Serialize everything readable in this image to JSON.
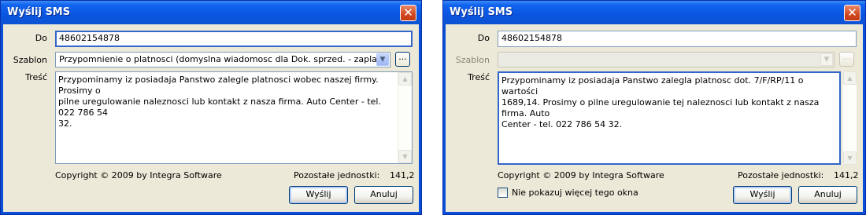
{
  "left": {
    "title": "Wyślij SMS",
    "close_glyph": "✕",
    "do_label": "Do",
    "do_value": "48602154878",
    "szablon_label": "Szablon",
    "szablon_value": "Przypomnienie o platnosci (domyslna wiadomosc dla Dok. sprzed. - zaplata).",
    "tresc_label": "Treść",
    "tresc_value": "Przypominamy iz posiadaja Panstwo zalegle platnosci wobec naszej firmy. Prosimy o\npilne uregulowanie naleznosci lub kontakt z nasza firma. Auto Center - tel. 022 786 54\n32.",
    "dots_label": "...",
    "copyright": "Copyright © 2009 by Integra Software",
    "remaining_label": "Pozostałe jednostki:",
    "remaining_value": "141,2",
    "send_label": "Wyślij",
    "cancel_label": "Anuluj"
  },
  "right": {
    "title": "Wyślij SMS",
    "close_glyph": "✕",
    "do_label": "Do",
    "do_value": "48602154878",
    "szablon_label": "Szablon",
    "szablon_value": "",
    "tresc_label": "Treść",
    "tresc_value": "Przypominamy iz posiadaja Panstwo zalegla platnosc dot. 7/F/RP/11 o wartości\n1689,14. Prosimy o pilne uregulowanie tej naleznosci lub kontakt z nasza firma. Auto\nCenter - tel. 022 786 54 32.",
    "dots_label": "...",
    "copyright": "Copyright © 2009 by Integra Software",
    "remaining_label": "Pozostałe jednostki:",
    "remaining_value": "141,2",
    "checkbox_label": "Nie pokazuj więcej tego okna",
    "checkbox_checked": false,
    "send_label": "Wyślij",
    "cancel_label": "Anuluj"
  },
  "icons": {
    "combo_arrow": "▼",
    "scroll_up": "▲",
    "scroll_down": "▼"
  },
  "colors": {
    "titlebar": "#0b4fd8",
    "dialog_face": "#ece9d8",
    "close_button": "#d1471f",
    "focus_border": "#3266c8"
  }
}
